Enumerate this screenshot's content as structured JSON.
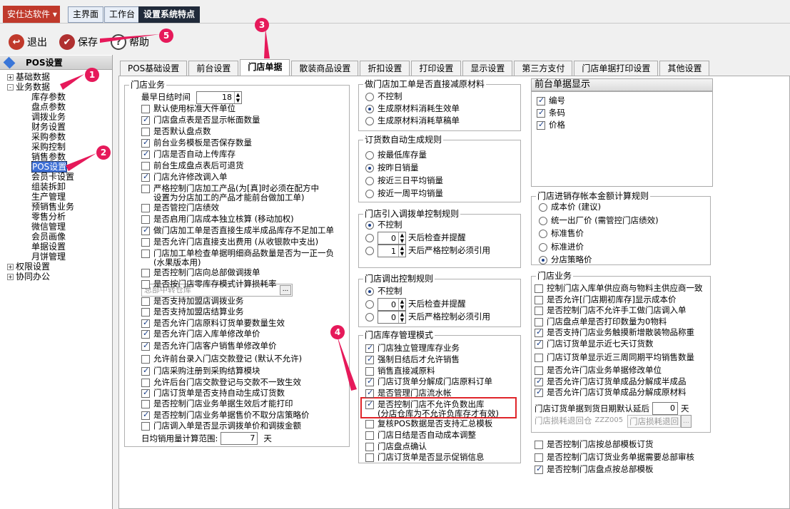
{
  "app": {
    "menu_button": "安仕达软件 ▾",
    "tabs": [
      "主界面",
      "工作台",
      "设置系统特点"
    ]
  },
  "toolbar": {
    "exit": "退出",
    "save": "保存",
    "help": "帮助"
  },
  "sidebar": {
    "title": "POS设置",
    "tree": [
      {
        "label": "基础数据",
        "level": 0,
        "expander": "+"
      },
      {
        "label": "业务数据",
        "level": 0,
        "expander": "-"
      },
      {
        "label": "库存参数",
        "level": 1
      },
      {
        "label": "盘点参数",
        "level": 1
      },
      {
        "label": "调拨业务",
        "level": 1
      },
      {
        "label": "财务设置",
        "level": 1
      },
      {
        "label": "采购参数",
        "level": 1
      },
      {
        "label": "采购控制",
        "level": 1
      },
      {
        "label": "销售参数",
        "level": 1
      },
      {
        "label": "POS设置",
        "level": 1,
        "selected": true
      },
      {
        "label": "会员卡设置",
        "level": 1
      },
      {
        "label": "组装拆卸",
        "level": 1
      },
      {
        "label": "生产管理",
        "level": 1
      },
      {
        "label": "预销售业务",
        "level": 1
      },
      {
        "label": "零售分析",
        "level": 1
      },
      {
        "label": "微信管理",
        "level": 1
      },
      {
        "label": "会员画像",
        "level": 1
      },
      {
        "label": "单据设置",
        "level": 1
      },
      {
        "label": "月饼管理",
        "level": 1
      },
      {
        "label": "权限设置",
        "level": 0,
        "expander": "+"
      },
      {
        "label": "协同办公",
        "level": 0,
        "expander": "+"
      }
    ]
  },
  "tabs": [
    "POS基础设置",
    "前台设置",
    "门店单据",
    "散装商品设置",
    "折扣设置",
    "打印设置",
    "显示设置",
    "第三方支付",
    "门店单据打印设置",
    "其他设置"
  ],
  "active_tab": "门店单据",
  "col1": {
    "title": "门店业务",
    "max_close_label": "最早日结时间",
    "max_close_value": "18",
    "items": [
      {
        "t": "默认使用标准大件单位",
        "on": false
      },
      {
        "t": "门店盘点表是否显示帐面数量",
        "on": true
      },
      {
        "t": "是否默认盘点数",
        "on": false
      },
      {
        "t": "前台业务模板是否保存数量",
        "on": true
      },
      {
        "t": "门店是否自动上传库存",
        "on": true
      },
      {
        "t": "前台生成盘点表后可退货",
        "on": false
      },
      {
        "t": "门店允许修改调入单",
        "on": true
      },
      {
        "t": "严格控制门店加工产品(为[真]时必须在配方中",
        "t2": "设置为分店加工的产品才能前台做加工单)",
        "on": false
      },
      {
        "t": "是否管控门店绩效",
        "on": false
      },
      {
        "t": "是否启用门店成本独立核算 (移动加权)",
        "on": false
      },
      {
        "t": "做门店加工单是否直接生成半成品库存不足加工单",
        "on": true
      },
      {
        "t": "是否允许门店直接支出费用 (从收银款中支出)",
        "on": false
      },
      {
        "t": "门店加工单检查单据明细商品数量是否为一正一负",
        "t2": "(水果版本用)",
        "on": false
      },
      {
        "t": "是否控制门店向总部做调拨单",
        "on": false
      },
      {
        "t": "是否按门店零库存模式计算损耗率",
        "on": false
      }
    ],
    "warehouse_placeholder": "总部中转仓库",
    "items2": [
      {
        "t": "是否支持加盟店调拨业务",
        "on": false
      },
      {
        "t": "是否支持加盟店结算业务",
        "on": false
      },
      {
        "t": "是否允许门店原料订货单要数量生效",
        "on": true
      },
      {
        "t": "是否允许门店入库单修改单价",
        "on": true
      },
      {
        "t": "是否允许门店客户销售单修改单价",
        "on": true
      },
      {
        "t": "允许前台录入门店交款登记 (默认不允许)",
        "on": false
      },
      {
        "t": "门店采购注册到采购结算模块",
        "on": true
      },
      {
        "t": "允许后台门店交款登记与交款不一致生效",
        "on": false
      },
      {
        "t": "门店订货单是否支持自动生成订货数",
        "on": true
      },
      {
        "t": "是否控制门店业务单据生效后才能打印",
        "on": false
      },
      {
        "t": "是否控制门店业务单据售价不取分店策略价",
        "on": true
      },
      {
        "t": "门店调入单是否显示调拨单价和调拨金额",
        "on": false
      }
    ],
    "daily_label": "日均销用量计算范围:",
    "daily_value": "7",
    "daily_unit": "天"
  },
  "col2": {
    "g1": {
      "title": "做门店加工单是否直接减原材料",
      "opts": [
        "不控制",
        "生成原材料消耗生效单",
        "生成原材料消耗草稿单"
      ],
      "sel": 1
    },
    "g2": {
      "title": "订货数自动生成规则",
      "opts": [
        "按最低库存量",
        "按昨日销量",
        "按近三日平均销量",
        "按近一周平均销量"
      ],
      "sel": 1
    },
    "g3": {
      "title": "门店引入调拨单控制规则",
      "opt0": "不控制",
      "v1": "0",
      "t1": "天后检查并提醒",
      "v2": "1",
      "t2": "天后严格控制必须引用",
      "sel": 0
    },
    "g4": {
      "title": "门店调出控制规则",
      "opt0": "不控制",
      "v1": "0",
      "t1": "天后检查并提醒",
      "v2": "0",
      "t2": "天后严格控制必须引用",
      "sel": 0
    },
    "g5": {
      "title": "门店库存管理模式",
      "items": [
        {
          "t": "门店独立管理库存业务",
          "on": true
        },
        {
          "t": "强制日结后才允许销售",
          "on": true
        },
        {
          "t": "销售直接减原料",
          "on": false
        },
        {
          "t": "门店订货单分解成门店原料订单",
          "on": true
        },
        {
          "t": "是否管理门店流水帐",
          "on": true
        },
        {
          "t": "是否控制门店不允许负数出库",
          "t2": "(分店仓库为不允许负库存才有效)",
          "on": true
        },
        {
          "t": "复核POS数据是否支持汇总模板",
          "on": false
        },
        {
          "t": "门店日结是否自动成本调整",
          "on": false
        },
        {
          "t": "门店盘点确认",
          "on": false
        },
        {
          "t": "门店订货单是否显示促销信息",
          "on": false
        }
      ]
    }
  },
  "col3": {
    "display_title": "前台单据显示",
    "display_items": [
      {
        "t": "编号",
        "on": true
      },
      {
        "t": "条码",
        "on": true
      },
      {
        "t": "价格",
        "on": true
      }
    ],
    "cost_title": "门店进销存帐本金额计算规则",
    "cost_opts": [
      "成本价 (建议)",
      "统一出厂价 (需管控门店绩效)",
      "标准售价",
      "标准进价",
      "分店策略价"
    ],
    "cost_sel": 4,
    "biz_title": "门店业务",
    "biz_items": [
      {
        "t": "控制门店入库单供应商与物料主供应商一致",
        "on": false
      },
      {
        "t": "是否允许[门店期初库存]显示成本价",
        "on": false
      },
      {
        "t": "是否控制门店不允许手工做门店调入单",
        "on": false
      },
      {
        "t": "门店盘点单是否打印数量为0物料",
        "on": false
      },
      {
        "t": "是否支持门店业务触摸新增散装物品称重",
        "on": true
      },
      {
        "t": "门店订货单显示近七天订货数",
        "on": true
      },
      {
        "t": "门店订货单显示近三周同期平均销售数量",
        "on": false
      },
      {
        "t": "是否允许门店业务单据修改单位",
        "on": false
      },
      {
        "t": "是否允许门店订货单成品分解成半成品",
        "on": true
      },
      {
        "t": "是否允许门店订货单成品分解成原材料",
        "on": true
      }
    ],
    "delay_label": "门店订货单据到货日期默认延后",
    "delay_value": "0",
    "delay_unit": "天",
    "loss_label": "门店损耗退回仓",
    "loss_code": "ZZZ005",
    "loss_value": "门店损耗退回",
    "bottom_items": [
      {
        "t": "是否控制门店按总部模板订货",
        "on": false
      },
      {
        "t": "是否控制门店订货业务单据需要总部审核",
        "on": false
      },
      {
        "t": "是否控制门店盘点按总部模板",
        "on": true
      }
    ]
  },
  "callouts": [
    "1",
    "2",
    "3",
    "4",
    "5"
  ],
  "colors": {
    "callout": "#e6195a",
    "highlight_box": "#e0252a"
  }
}
